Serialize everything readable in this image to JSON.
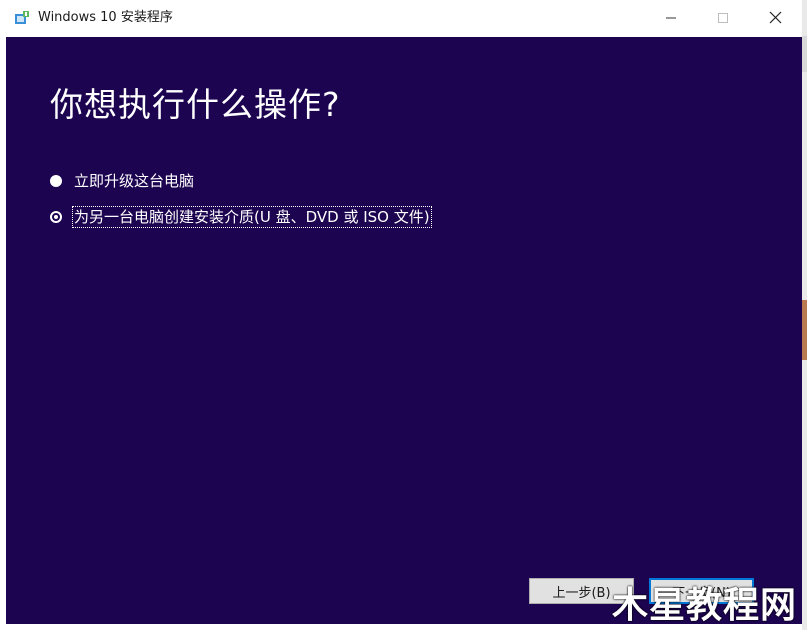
{
  "window": {
    "title": "Windows 10 安装程序",
    "icons": {
      "app": "setup-app-icon",
      "minimize": "minimize-icon",
      "maximize": "maximize-icon",
      "close": "close-icon"
    }
  },
  "main": {
    "heading": "你想执行什么操作?",
    "options": [
      {
        "label": "立即升级这台电脑",
        "selected": false
      },
      {
        "label": "为另一台电脑创建安装介质(U 盘、DVD 或 ISO 文件)",
        "selected": true
      }
    ]
  },
  "footer": {
    "back_label": "上一步(B)",
    "next_label": "下一步(N)"
  },
  "watermark": "木星教程网",
  "colors": {
    "background": "#1c0450",
    "text": "#ffffff",
    "focus_border": "#0078d7"
  }
}
